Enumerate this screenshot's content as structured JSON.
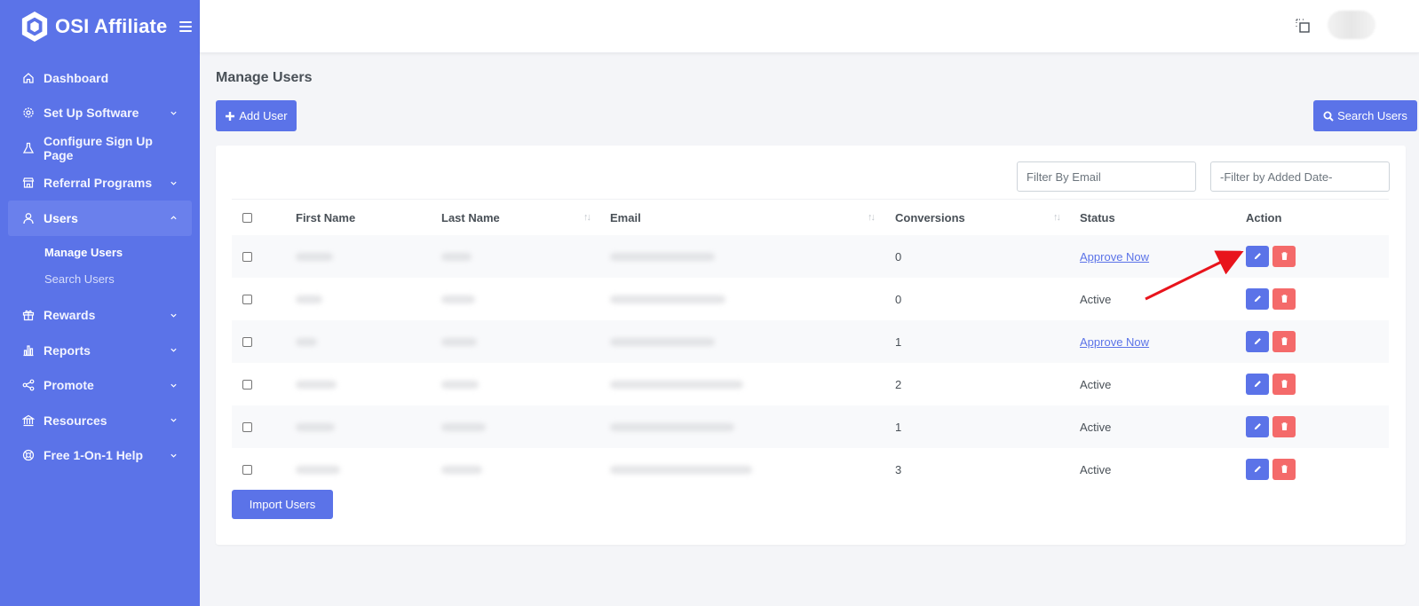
{
  "brand": {
    "title": "OSI Affiliate"
  },
  "sidebar": {
    "items": [
      {
        "label": "Dashboard",
        "icon": "home-icon",
        "has_children": false
      },
      {
        "label": "Set Up Software",
        "icon": "gear-icon",
        "has_children": true
      },
      {
        "label": "Configure Sign Up Page",
        "icon": "flask-icon",
        "has_children": false
      },
      {
        "label": "Referral Programs",
        "icon": "store-icon",
        "has_children": true
      },
      {
        "label": "Users",
        "icon": "user-icon",
        "has_children": true,
        "expanded": true
      },
      {
        "label": "Rewards",
        "icon": "gift-icon",
        "has_children": true
      },
      {
        "label": "Reports",
        "icon": "bar-chart-icon",
        "has_children": true
      },
      {
        "label": "Promote",
        "icon": "share-icon",
        "has_children": true
      },
      {
        "label": "Resources",
        "icon": "bank-icon",
        "has_children": true
      },
      {
        "label": "Free 1-On-1 Help",
        "icon": "lifebuoy-icon",
        "has_children": true
      }
    ],
    "users_sub": [
      {
        "label": "Manage Users",
        "current": true
      },
      {
        "label": "Search Users",
        "current": false
      }
    ]
  },
  "page": {
    "title": "Manage Users",
    "add_user": "Add User",
    "search_users": "Search Users",
    "import_users": "Import Users"
  },
  "filters": {
    "email_placeholder": "Filter By Email",
    "date_placeholder": "-Filter by Added Date-"
  },
  "table": {
    "headers": {
      "first_name": "First Name",
      "last_name": "Last Name",
      "email": "Email",
      "conversions": "Conversions",
      "status": "Status",
      "action": "Action"
    },
    "rows": [
      {
        "conversions": "0",
        "status": "Approve Now",
        "status_is_link": true
      },
      {
        "conversions": "0",
        "status": "Active",
        "status_is_link": false
      },
      {
        "conversions": "1",
        "status": "Approve Now",
        "status_is_link": true
      },
      {
        "conversions": "2",
        "status": "Active",
        "status_is_link": false
      },
      {
        "conversions": "1",
        "status": "Active",
        "status_is_link": false
      },
      {
        "conversions": "3",
        "status": "Active",
        "status_is_link": false
      }
    ]
  },
  "colors": {
    "sidebar": "#5b73e8",
    "primary": "#5b73e8",
    "danger": "#f46a6a",
    "annotation_arrow": "#e8141c"
  }
}
